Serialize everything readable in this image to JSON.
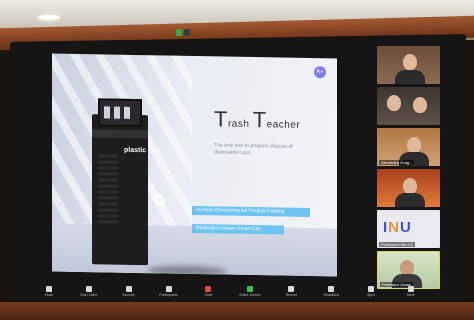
{
  "meeting": {
    "share_indicator": "",
    "share_stop": ""
  },
  "slide": {
    "title_big1": "T",
    "title_rest1": "rash ",
    "title_big2": "T",
    "title_rest2": "eacher",
    "subtitle": "The only way to properly dispose of disposable cups",
    "kiosk_label": "plastic cup",
    "tag1": "Incheon Environmental Product Catalog",
    "tag2": "Redesign's Green Smart City",
    "badge": "A+"
  },
  "participants": [
    {
      "name": ""
    },
    {
      "name": ""
    },
    {
      "name": "Alexandra Grag..."
    },
    {
      "name": ""
    },
    {
      "name": "Professor Han Gil"
    },
    {
      "name": "Professor Jonas"
    }
  ],
  "logo_text": [
    "I",
    "N",
    "U"
  ],
  "toolbar": [
    {
      "label": "Mute",
      "state": "normal"
    },
    {
      "label": "Stop Video",
      "state": "normal"
    },
    {
      "label": "Security",
      "state": "normal"
    },
    {
      "label": "Participants",
      "state": "normal"
    },
    {
      "label": "Chat",
      "state": "red"
    },
    {
      "label": "Share Screen",
      "state": "green"
    },
    {
      "label": "Record",
      "state": "normal"
    },
    {
      "label": "Reactions",
      "state": "normal"
    },
    {
      "label": "Apps",
      "state": "normal"
    },
    {
      "label": "More",
      "state": "normal"
    }
  ]
}
